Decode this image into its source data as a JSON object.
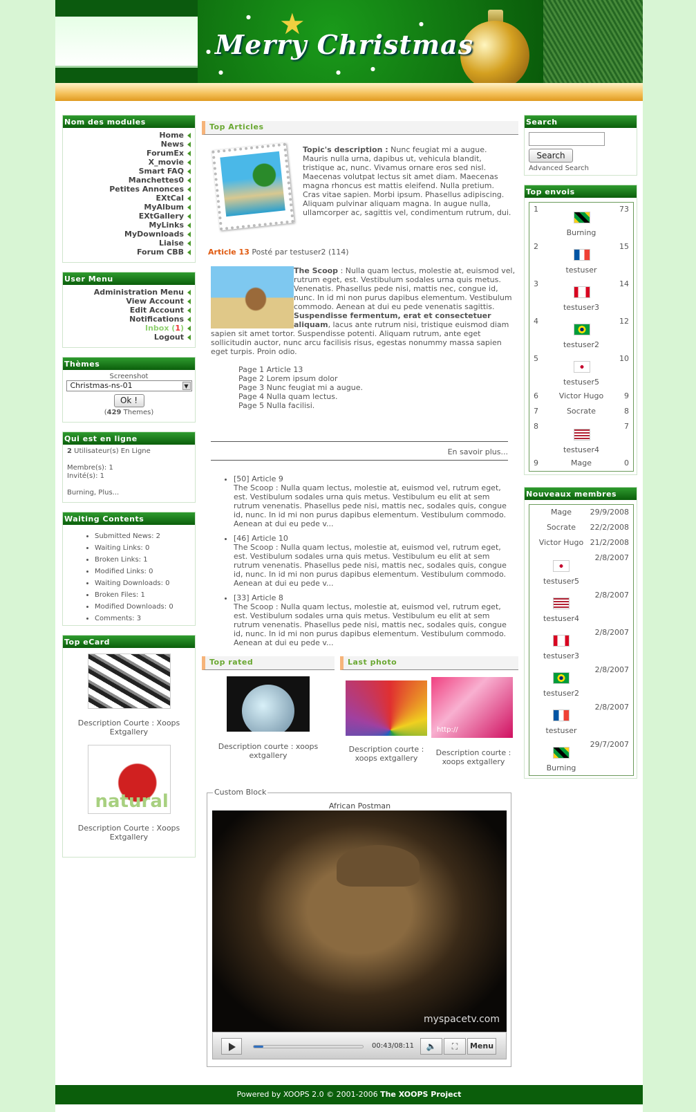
{
  "header": {
    "title": "Merry Christmas"
  },
  "modules": {
    "title": "Nom des modules",
    "items": [
      "Home",
      "News",
      "ForumEx",
      "X_movie",
      "Smart FAQ",
      "Manchettes0",
      "Petites Annonces",
      "EXtCal",
      "MyAlbum",
      "EXtGallery",
      "MyLinks",
      "MyDownloads",
      "Liaise",
      "Forum CBB"
    ]
  },
  "usermenu": {
    "title": "User Menu",
    "items": [
      "Administration Menu",
      "View Account",
      "Edit Account",
      "Notifications"
    ],
    "inbox_label": "Inbox",
    "inbox_open": " (",
    "inbox_count": "1",
    "inbox_close": ")",
    "logout": "Logout"
  },
  "themes": {
    "title": "Thèmes",
    "screenshot_label": "Screenshot",
    "selected": "Christmas-ns-01",
    "ok_label": "Ok !",
    "count_open": "(",
    "count": "429",
    "count_suffix": " Themes)"
  },
  "online": {
    "title": "Qui est en ligne",
    "count": "2",
    "users_label": " Utilisateur(s) En Ligne",
    "members": "Membre(s): 1",
    "guests": "Invité(s): 1",
    "names": "Burning, Plus..."
  },
  "waiting": {
    "title": "Waiting Contents",
    "items": [
      "Submitted News: 2",
      "Waiting Links: 0",
      "Broken Links: 1",
      "Modified Links: 0",
      "Waiting Downloads: 0",
      "Broken Files: 1",
      "Modified Downloads: 0",
      "Comments: 3"
    ]
  },
  "ecard": {
    "title": "Top eCard",
    "desc1": "Description Courte : Xoops Extgallery",
    "desc2": "Description Courte : Xoops Extgallery",
    "natural_text": "natural"
  },
  "top_articles": {
    "title": "Top Articles",
    "topic_label": "Topic's description :",
    "topic_text": "Nunc feugiat mi a augue. Mauris nulla urna, dapibus ut, vehicula blandit, tristique ac, nunc. Vivamus ornare eros sed nisl. Maecenas volutpat lectus sit amet diam. Maecenas magna rhoncus est mattis eleifend. Nulla pretium. Cras vitae sapien. Morbi ipsum. Phasellus adipiscing. Aliquam pulvinar aliquam magna. In augue nulla, ullamcorper ac, sagittis vel, condimentum rutrum, dui.",
    "article_title": "Article 13",
    "posted_by": "Posté par testuser2 (114)",
    "scoop_label": "The Scoop",
    "scoop_text1": ": Nulla quam lectus, molestie at, euismod vel, rutrum eget, est. Vestibulum sodales urna quis metus. Venenatis. Phasellus pede nisi, mattis nec, congue id, nunc. In id mi non purus dapibus elementum. Vestibulum commodo. Aenean at dui eu pede venenatis sagittis.",
    "scoop_bold": "Suspendisse fermentum, erat et consectetuer aliquam",
    "scoop_text2": ", lacus ante rutrum nisi, tristique euismod diam sapien sit amet tortor. Suspendisse potenti. Aliquam rutrum, ante eget sollicitudin auctor, nunc arcu facilisis risus, egestas nonummy massa sapien eget turpis. Proin odio.",
    "pages": [
      "Page 1 Article 13",
      "Page 2 Lorem ipsum dolor",
      "Page 3 Nunc feugiat mi a augue.",
      "Page 4 Nulla quam lectus.",
      "Page 5 Nulla facilisi."
    ],
    "more": "En savoir plus...",
    "list": [
      {
        "title": "[50] Article 9",
        "text": "The Scoop : Nulla quam lectus, molestie at, euismod vel, rutrum eget, est. Vestibulum sodales urna quis metus. Vestibulum eu elit at sem rutrum venenatis. Phasellus pede nisi, mattis nec, sodales quis, congue id, nunc. In id mi non purus dapibus elementum. Vestibulum commodo. Aenean at dui eu pede v..."
      },
      {
        "title": "[46] Article 10",
        "text": "The Scoop : Nulla quam lectus, molestie at, euismod vel, rutrum eget, est. Vestibulum sodales urna quis metus. Vestibulum eu elit at sem rutrum venenatis. Phasellus pede nisi, mattis nec, sodales quis, congue id, nunc. In id mi non purus dapibus elementum. Vestibulum commodo. Aenean at dui eu pede v..."
      },
      {
        "title": "[33] Article 8",
        "text": "The Scoop : Nulla quam lectus, molestie at, euismod vel, rutrum eget, est. Vestibulum sodales urna quis metus. Vestibulum eu elit at sem rutrum venenatis. Phasellus pede nisi, mattis nec, sodales quis, congue id, nunc. In id mi non purus dapibus elementum. Vestibulum commodo. Aenean at dui eu pede v..."
      }
    ]
  },
  "top_rated": {
    "title": "Top rated",
    "desc": "Description courte : xoops extgallery"
  },
  "last_photo": {
    "title": "Last photo",
    "desc1": "Description courte : xoops extgallery",
    "desc2": "Description courte : xoops extgallery",
    "photo_text": "http://"
  },
  "custom_block": {
    "legend": "Custom Block",
    "video_title": "African Postman",
    "watermark": "myspacetv.com",
    "time": "00:43/08:11",
    "menu": "Menu",
    "progress": 0.09
  },
  "search": {
    "title": "Search",
    "button": "Search",
    "advanced": "Advanced Search",
    "input_value": ""
  },
  "top_envois": {
    "title": "Top envois",
    "rows": [
      {
        "rank": "1",
        "name": "Burning",
        "count": "73",
        "flag": "jm"
      },
      {
        "rank": "2",
        "name": "testuser",
        "count": "15",
        "flag": "fr"
      },
      {
        "rank": "3",
        "name": "testuser3",
        "count": "14",
        "flag": "ca"
      },
      {
        "rank": "4",
        "name": "testuser2",
        "count": "12",
        "flag": "br"
      },
      {
        "rank": "5",
        "name": "testuser5",
        "count": "10",
        "flag": "kr"
      },
      {
        "rank": "6",
        "name": "Victor Hugo",
        "count": "9",
        "flag": ""
      },
      {
        "rank": "7",
        "name": "Socrate",
        "count": "8",
        "flag": ""
      },
      {
        "rank": "8",
        "name": "testuser4",
        "count": "7",
        "flag": "us"
      },
      {
        "rank": "9",
        "name": "Mage",
        "count": "0",
        "flag": ""
      }
    ]
  },
  "new_members": {
    "title": "Nouveaux membres",
    "rows": [
      {
        "name": "Mage",
        "date": "29/9/2008",
        "flag": ""
      },
      {
        "name": "Socrate",
        "date": "22/2/2008",
        "flag": ""
      },
      {
        "name": "Victor Hugo",
        "date": "21/2/2008",
        "flag": ""
      },
      {
        "name": "testuser5",
        "date": "2/8/2007",
        "flag": "kr"
      },
      {
        "name": "testuser4",
        "date": "2/8/2007",
        "flag": "us"
      },
      {
        "name": "testuser3",
        "date": "2/8/2007",
        "flag": "ca"
      },
      {
        "name": "testuser2",
        "date": "2/8/2007",
        "flag": "br"
      },
      {
        "name": "testuser",
        "date": "2/8/2007",
        "flag": "fr"
      },
      {
        "name": "Burning",
        "date": "29/7/2007",
        "flag": "jm"
      }
    ]
  },
  "footer": {
    "prefix": "Powered by XOOPS 2.0 © 2001-2006 ",
    "project": "The XOOPS Project"
  }
}
